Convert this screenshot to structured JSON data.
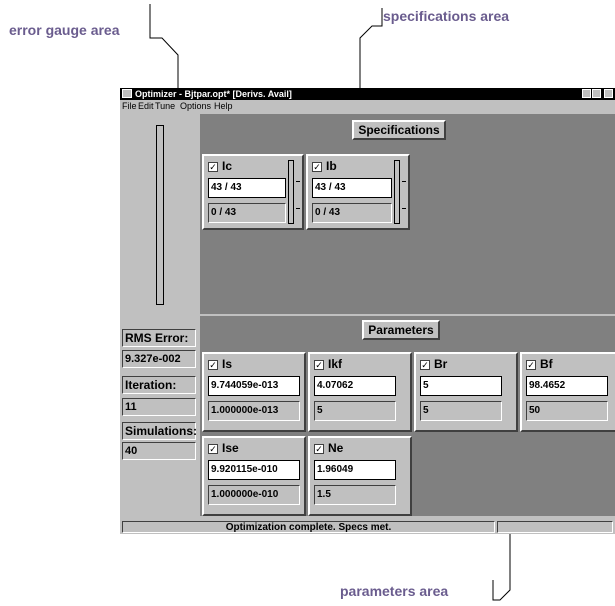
{
  "callouts": {
    "error_gauge": "error gauge area",
    "specifications": "specifications area",
    "parameters": "parameters area"
  },
  "window": {
    "title": "Optimizer - Bjtpar.opt*  [Derivs. Avail]",
    "menu": [
      "File",
      "Edit",
      "Tune",
      "Options",
      "Help"
    ]
  },
  "left_panel": {
    "gauge_level": 0.0,
    "rms_label": "RMS Error:",
    "rms_value": "9.327e-002",
    "iteration_label": "Iteration:",
    "iteration_value": "11",
    "simulations_label": "Simulations:",
    "simulations_value": "40"
  },
  "specifications": {
    "heading": "Specifications",
    "cards": [
      {
        "name": "Ic",
        "checked": true,
        "value": "43 / 43",
        "sub": "0 / 43"
      },
      {
        "name": "Ib",
        "checked": true,
        "value": "43 / 43",
        "sub": "0 / 43"
      }
    ]
  },
  "parameters": {
    "heading": "Parameters",
    "cards": [
      {
        "name": "Is",
        "checked": true,
        "value": "9.744059e-013",
        "sub": "1.000000e-013"
      },
      {
        "name": "Ikf",
        "checked": true,
        "value": "4.07062",
        "sub": "5"
      },
      {
        "name": "Br",
        "checked": true,
        "value": "5",
        "sub": "5"
      },
      {
        "name": "Bf",
        "checked": true,
        "value": "98.4652",
        "sub": "50"
      },
      {
        "name": "Ise",
        "checked": true,
        "value": "9.920115e-010",
        "sub": "1.000000e-010"
      },
      {
        "name": "Ne",
        "checked": true,
        "value": "1.96049",
        "sub": "1.5"
      }
    ]
  },
  "status": {
    "message": "Optimization complete.  Specs met."
  },
  "colors": {
    "callout": "#6a5c8e",
    "panel": "#c0c0c0",
    "workspace": "#808080",
    "titlebar": "#000000"
  }
}
